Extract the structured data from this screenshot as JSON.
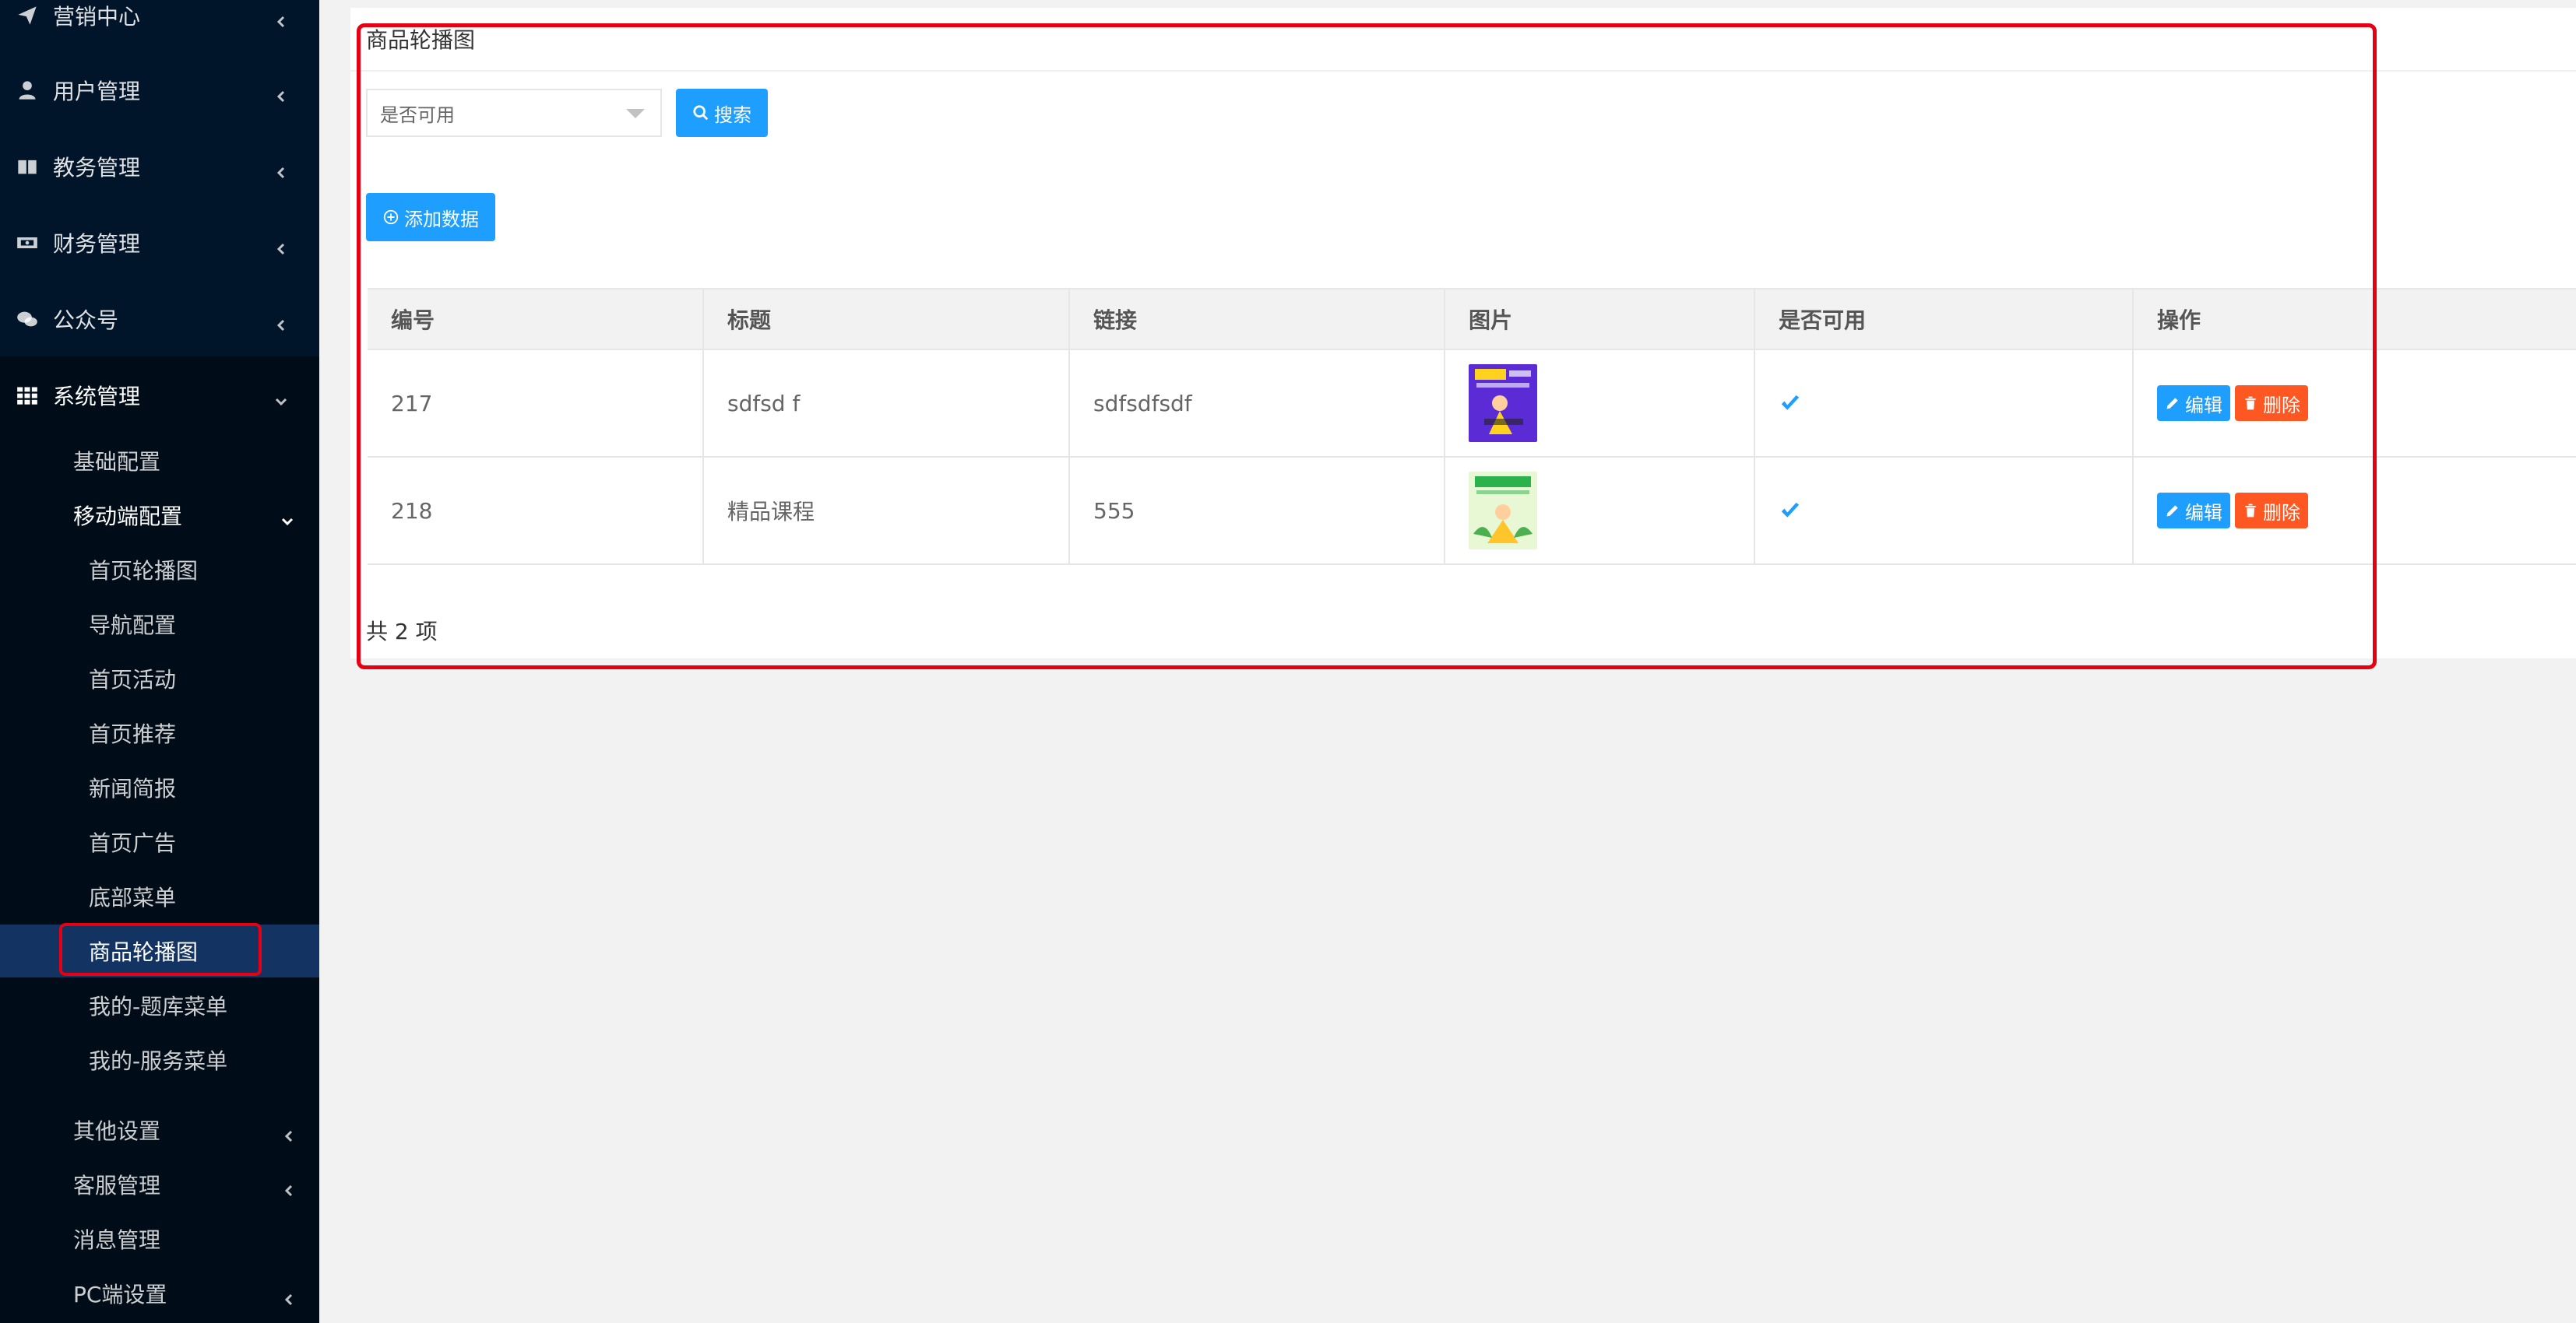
{
  "sidebar": {
    "top_items": [
      {
        "label": "营销中心",
        "icon": "paper-plane-icon"
      },
      {
        "label": "用户管理",
        "icon": "user-icon"
      },
      {
        "label": "教务管理",
        "icon": "book-icon"
      },
      {
        "label": "财务管理",
        "icon": "money-icon"
      },
      {
        "label": "公众号",
        "icon": "wechat-icon"
      }
    ],
    "system": {
      "label": "系统管理",
      "icon": "grid-icon"
    },
    "sub_items": {
      "basic": "基础配置",
      "mobile": "移动端配置",
      "mobile_children": [
        "首页轮播图",
        "导航配置",
        "首页活动",
        "首页推荐",
        "新闻简报",
        "首页广告",
        "底部菜单",
        "商品轮播图",
        "我的-题库菜单",
        "我的-服务菜单"
      ],
      "other": "其他设置",
      "service": "客服管理",
      "message": "消息管理",
      "pc": "PC端设置"
    }
  },
  "main": {
    "title": "商品轮播图",
    "filter": {
      "placeholder": "是否可用",
      "search_label": "搜索"
    },
    "add_label": "添加数据",
    "table": {
      "headers": [
        "编号",
        "标题",
        "链接",
        "图片",
        "是否可用",
        "操作"
      ],
      "rows": [
        {
          "id": "217",
          "title": "sdfsd f",
          "link": "sdfsdfsdf",
          "enabled": true
        },
        {
          "id": "218",
          "title": "精品课程",
          "link": "555",
          "enabled": true
        }
      ],
      "edit_label": "编辑",
      "delete_label": "删除"
    },
    "total": "共 2 项"
  }
}
